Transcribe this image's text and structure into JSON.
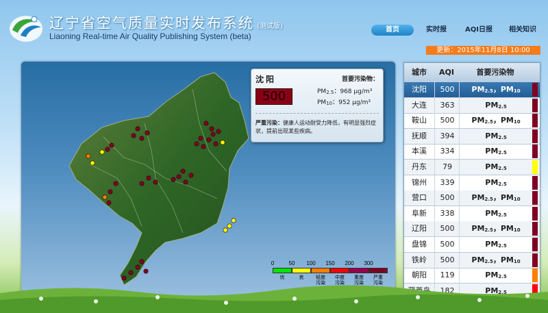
{
  "header": {
    "title_zh": "辽宁省空气质量实时发布系统",
    "title_beta": "(测试版)",
    "title_en": "Liaoning Real-time Air Quality Publishing System (beta)",
    "logo_icon": "leaf-swan-logo-icon"
  },
  "nav": [
    {
      "label": "首页",
      "active": true
    },
    {
      "label": "实时报",
      "active": false
    },
    {
      "label": "AQI日报",
      "active": false
    },
    {
      "label": "相关知识",
      "active": false
    }
  ],
  "update_time": "更新：2015年11月8日  10:00",
  "popup": {
    "city": "沈阳",
    "aqi": "500",
    "pollutant_label": "首要污染物：",
    "pm25_label": "PM",
    "pm25_sub": "2.5",
    "pm25_value": "：968 μg/m³",
    "pm10_label": "PM",
    "pm10_sub": "10",
    "pm10_value": "：952 μg/m³",
    "level_label": "严重污染：",
    "level_text": "健康人运动耐受力降低，有明显强烈症状，提前出现某些疾病。",
    "close_icon": "close-icon"
  },
  "legend": {
    "ticks": [
      "0",
      "50",
      "100",
      "150",
      "200",
      "300"
    ],
    "categories": [
      "优",
      "良",
      "轻度\n污染",
      "中度\n污染",
      "重度\n污染",
      "严重\n污染"
    ],
    "colors": [
      "#00e400",
      "#ffff00",
      "#ff7e00",
      "#ff0000",
      "#99004c",
      "#7e0023"
    ]
  },
  "table": {
    "headers": [
      "城市",
      "AQI",
      "首要污染物"
    ],
    "rows": [
      {
        "city": "沈阳",
        "aqi": "500",
        "p1": "PM",
        "s1": "2.5",
        "sep": "，",
        "p2": "PM",
        "s2": "10",
        "color": "#7e0023",
        "selected": true
      },
      {
        "city": "大连",
        "aqi": "363",
        "p1": "PM",
        "s1": "2.5",
        "sep": "",
        "p2": "",
        "s2": "",
        "color": "#7e0023"
      },
      {
        "city": "鞍山",
        "aqi": "500",
        "p1": "PM",
        "s1": "2.5",
        "sep": "，",
        "p2": "PM",
        "s2": "10",
        "color": "#7e0023"
      },
      {
        "city": "抚顺",
        "aqi": "394",
        "p1": "PM",
        "s1": "2.5",
        "sep": "",
        "p2": "",
        "s2": "",
        "color": "#7e0023"
      },
      {
        "city": "本溪",
        "aqi": "334",
        "p1": "PM",
        "s1": "2.5",
        "sep": "",
        "p2": "",
        "s2": "",
        "color": "#7e0023"
      },
      {
        "city": "丹东",
        "aqi": "79",
        "p1": "PM",
        "s1": "2.5",
        "sep": "",
        "p2": "",
        "s2": "",
        "color": "#ffff00"
      },
      {
        "city": "锦州",
        "aqi": "339",
        "p1": "PM",
        "s1": "2.5",
        "sep": "",
        "p2": "",
        "s2": "",
        "color": "#7e0023"
      },
      {
        "city": "营口",
        "aqi": "500",
        "p1": "PM",
        "s1": "2.5",
        "sep": "，",
        "p2": "PM",
        "s2": "10",
        "color": "#7e0023"
      },
      {
        "city": "阜新",
        "aqi": "338",
        "p1": "PM",
        "s1": "2.5",
        "sep": "",
        "p2": "",
        "s2": "",
        "color": "#7e0023"
      },
      {
        "city": "辽阳",
        "aqi": "500",
        "p1": "PM",
        "s1": "2.5",
        "sep": "，",
        "p2": "PM",
        "s2": "10",
        "color": "#7e0023"
      },
      {
        "city": "盘锦",
        "aqi": "500",
        "p1": "PM",
        "s1": "2.5",
        "sep": "",
        "p2": "",
        "s2": "",
        "color": "#7e0023"
      },
      {
        "city": "铁岭",
        "aqi": "500",
        "p1": "PM",
        "s1": "2.5",
        "sep": "，",
        "p2": "PM",
        "s2": "10",
        "color": "#7e0023"
      },
      {
        "city": "朝阳",
        "aqi": "119",
        "p1": "PM",
        "s1": "2.5",
        "sep": "",
        "p2": "",
        "s2": "",
        "color": "#ff7e00"
      },
      {
        "city": "葫芦岛",
        "aqi": "182",
        "p1": "PM",
        "s1": "2.5",
        "sep": "",
        "p2": "",
        "s2": "",
        "color": "#ff0000"
      }
    ]
  },
  "map": {
    "station_colors": {
      "severe": "#7e0023",
      "heavy": "#99004c",
      "moderate": "#ff7e00",
      "good": "#ffff00"
    },
    "map_icon": "liaoning-province-map-icon"
  }
}
